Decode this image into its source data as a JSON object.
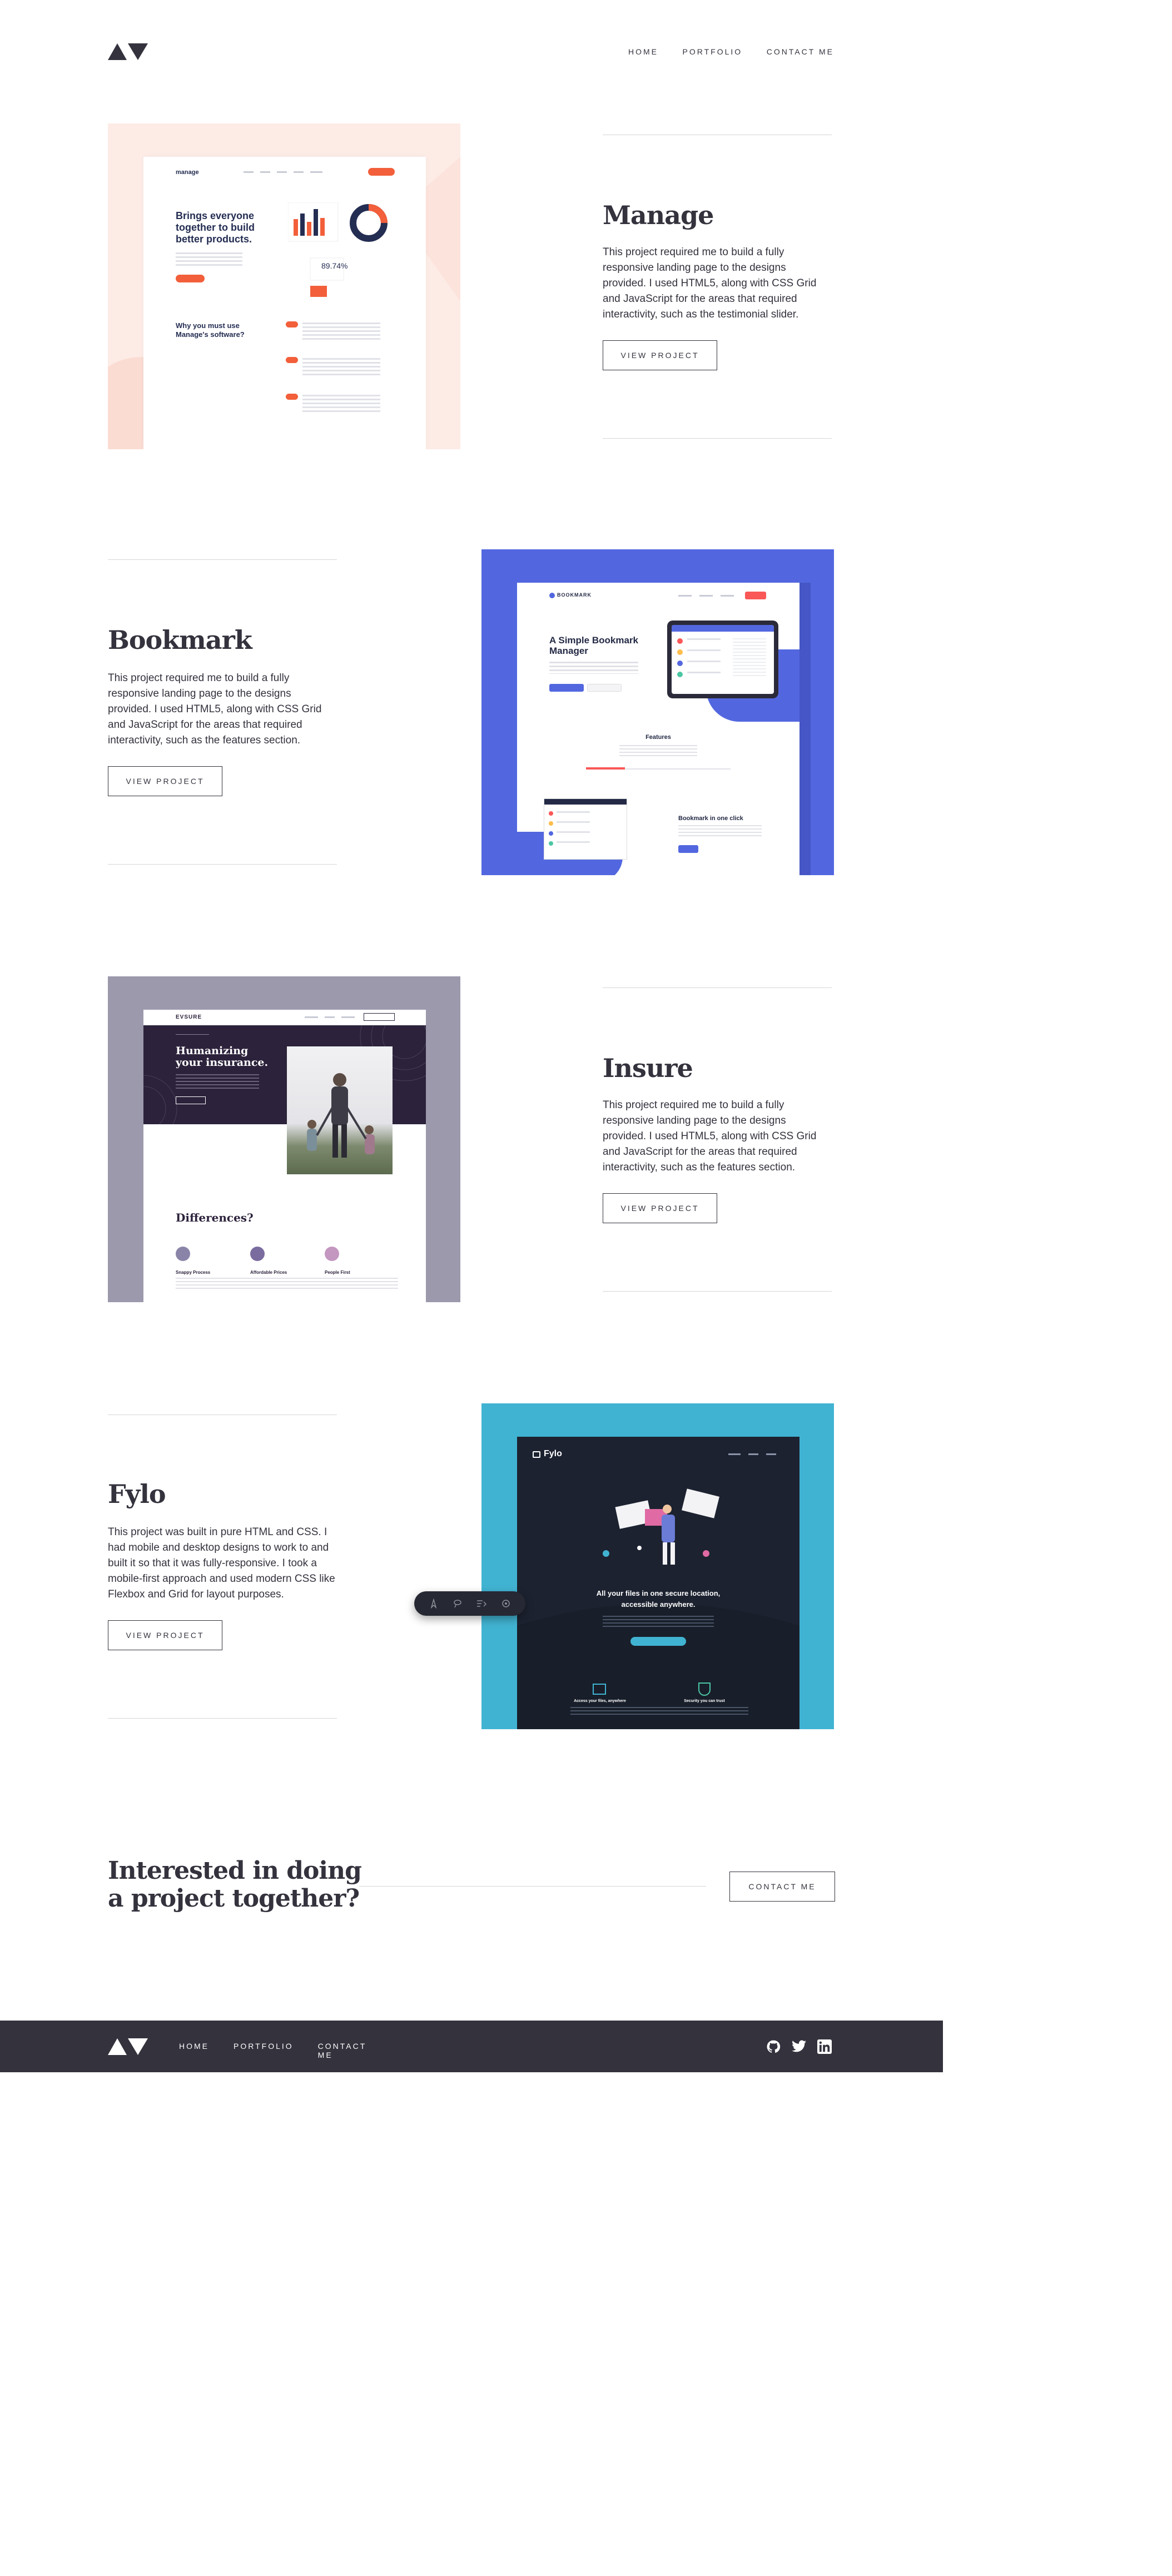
{
  "header": {
    "nav": [
      "HOME",
      "PORTFOLIO",
      "CONTACT ME"
    ]
  },
  "projects": [
    {
      "title": "Manage",
      "description": "This project required me to build a fully responsive landing page to the designs provided. I used HTML5, along with CSS Grid and JavaScript for the areas that required interactivity, such as the testimonial slider.",
      "button": "VIEW PROJECT",
      "preview": {
        "logo": "manage",
        "headline": "Brings everyone together to build better products.",
        "stat": "89.74%",
        "section": "Why you must use Manage's software?"
      }
    },
    {
      "title": "Bookmark",
      "description": "This project required me to build a fully responsive landing page to the designs provided. I used HTML5, along with CSS Grid and JavaScript for the areas that required interactivity, such as the features section.",
      "button": "VIEW PROJECT",
      "preview": {
        "logo": "BOOKMARK",
        "headline": "A Simple Bookmark Manager",
        "section": "Features",
        "subsection": "Bookmark in one click"
      }
    },
    {
      "title": "Insure",
      "description": "This project required me to build a fully responsive landing page to the designs provided. I used HTML5, along with CSS Grid and JavaScript for the areas that required interactivity, such as the features section.",
      "button": "VIEW PROJECT",
      "preview": {
        "logo": "EVSURE",
        "headline": "Humanizing your insurance.",
        "section": "Differences?",
        "features": [
          "Snappy Process",
          "Affordable Prices",
          "People First"
        ]
      }
    },
    {
      "title": "Fylo",
      "description": "This project was built in pure HTML and CSS. I had mobile and desktop designs to work to and built it so that it was fully-responsive. I took a mobile-first approach and used modern CSS like Flexbox and Grid for layout purposes.",
      "button": "VIEW PROJECT",
      "preview": {
        "logo": "Fylo",
        "headline": "All your files in one secure location, accessible anywhere.",
        "feature1": "Access your files, anywhere",
        "feature2": "Security you can trust"
      }
    }
  ],
  "contact": {
    "heading_line1": "Interested in doing",
    "heading_line2": "a project together?",
    "button": "CONTACT ME"
  },
  "footer": {
    "nav": [
      "HOME",
      "PORTFOLIO",
      "CONTACT ME"
    ],
    "social": [
      "github-icon",
      "twitter-icon",
      "linkedin-icon"
    ]
  },
  "colors": {
    "dark": "#33323d",
    "manage_bg": "#fdebe6",
    "manage_accent": "#f25f3a",
    "bookmark_bg": "#5267df",
    "insure_bg": "#9c99ad",
    "insure_dark": "#2c223b",
    "fylo_bg": "#41b3d2",
    "fylo_dark": "#1c2230"
  }
}
